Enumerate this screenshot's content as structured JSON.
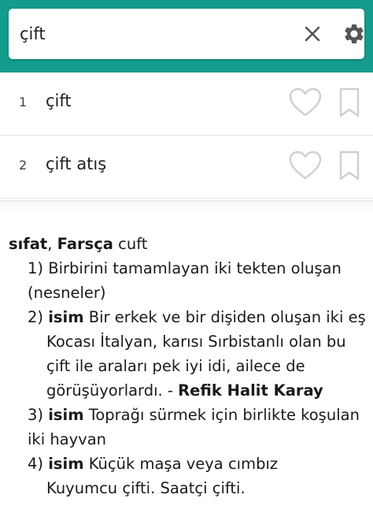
{
  "search": {
    "value": "çift"
  },
  "results": [
    {
      "num": "1",
      "word": "çift"
    },
    {
      "num": "2",
      "word": "çift atış"
    }
  ],
  "definition": {
    "pos": "sıfat",
    "origin_label": "Farsça",
    "origin_word": "cuft",
    "senses": [
      {
        "num": "1)",
        "text": "Birbirini tamamlayan iki tekten oluşan (nesneler)"
      },
      {
        "num": "2)",
        "tag": "isim",
        "text": "Bir erkek ve bir dişiden oluşan iki eş"
      },
      {
        "num": "3)",
        "tag": "isim",
        "text": "Toprağı sürmek için birlikte koşulan iki hayvan"
      },
      {
        "num": "4)",
        "tag": "isim",
        "text": "Küçük maşa veya cımbız"
      }
    ],
    "example_2": "Kocası İtalyan, karısı Sırbistanlı olan bu çift ile araları pek iyi idi, ailece de görüşüyorlardı. -",
    "example_2_author": "Refik Halit Karay",
    "example_4": "Kuyumcu çifti. Saatçi çifti."
  },
  "colors": {
    "header": "#139c8c",
    "icon": "#666666",
    "outline_icon": "#cccccc"
  }
}
